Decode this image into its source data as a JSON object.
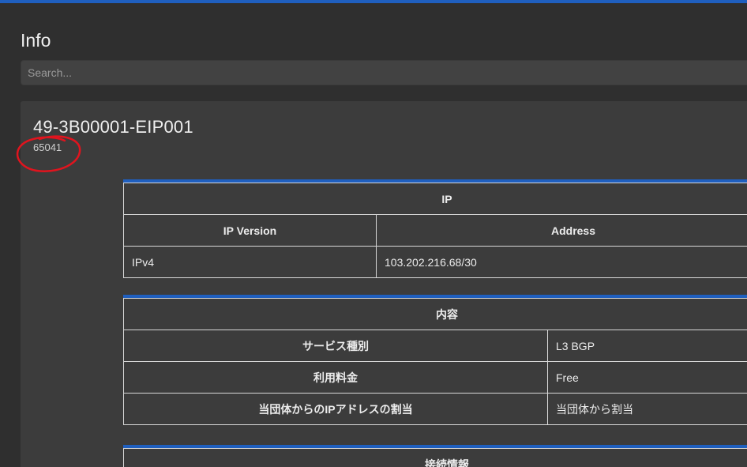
{
  "page": {
    "title": "Info"
  },
  "search": {
    "placeholder": "Search..."
  },
  "record": {
    "title": "49-3B00001-EIP001",
    "subtitle": "65041"
  },
  "ip_table": {
    "caption": "IP",
    "headers": [
      "IP Version",
      "Address"
    ],
    "rows": [
      [
        "IPv4",
        "103.202.216.68/30"
      ]
    ]
  },
  "content_table": {
    "caption": "内容",
    "rows": [
      [
        "サービス種別",
        "L3 BGP"
      ],
      [
        "利用料金",
        "Free"
      ],
      [
        "当団体からのIPアドレスの割当",
        "当団体から割当"
      ]
    ]
  },
  "connection_table": {
    "caption": "接続情報"
  },
  "colors": {
    "accent": "#1f5fbf",
    "annotation": "#e0141e",
    "background": "#2f2f2f",
    "card": "#3c3c3c"
  }
}
